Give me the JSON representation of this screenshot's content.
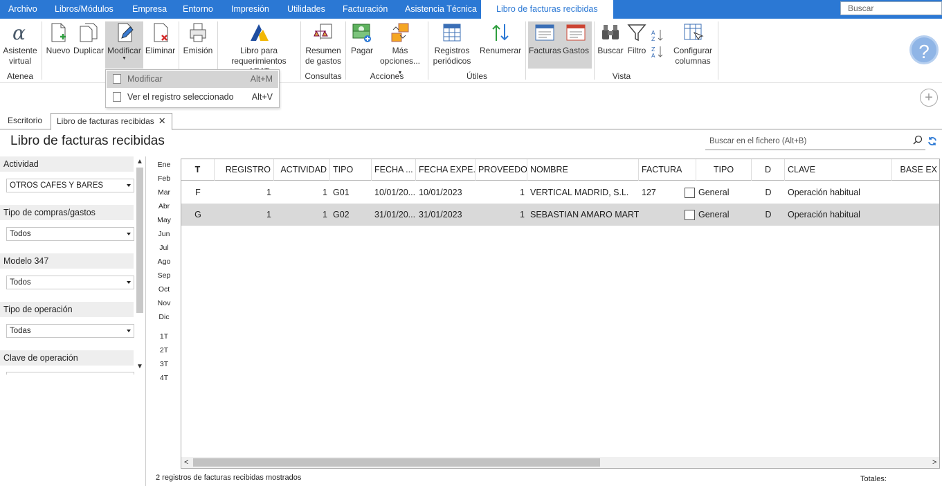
{
  "menubar": {
    "items": [
      "Archivo",
      "Libros/Módulos",
      "Empresa",
      "Entorno",
      "Impresión",
      "Utilidades",
      "Facturación",
      "Asistencia Técnica",
      "Libro de facturas recibidas"
    ],
    "search_placeholder": "Buscar"
  },
  "ribbon": {
    "asistente": [
      "Asistente",
      "virtual"
    ],
    "nuevo": "Nuevo",
    "duplicar": "Duplicar",
    "modificar": "Modificar",
    "eliminar": "Eliminar",
    "emision": "Emisión",
    "libro": [
      "Libro para",
      "requerimientos AEAT"
    ],
    "resumen": [
      "Resumen",
      "de gastos"
    ],
    "pagar": "Pagar",
    "mas": [
      "Más",
      "opciones..."
    ],
    "registros": [
      "Registros",
      "periódicos"
    ],
    "renumerar": "Renumerar",
    "facturas": "Facturas",
    "gastos": "Gastos",
    "buscar": "Buscar",
    "filtro": "Filtro",
    "configurar": [
      "Configurar",
      "columnas"
    ],
    "groups": {
      "atenea": "Atenea",
      "consultas": "Consultas",
      "acciones": "Acciones",
      "utiles": "Útiles",
      "vista": "Vista"
    }
  },
  "dropdown": {
    "items": [
      {
        "label": "Modificar",
        "shortcut": "Alt+M"
      },
      {
        "label": "Ver el registro seleccionado",
        "shortcut": "Alt+V"
      }
    ]
  },
  "tabs": [
    "Escritorio",
    "Libro de facturas recibidas"
  ],
  "page_title": "Libro de facturas recibidas",
  "file_search_placeholder": "Buscar en el fichero (Alt+B)",
  "filters": [
    {
      "label": "Actividad",
      "value": "OTROS CAFES Y BARES"
    },
    {
      "label": "Tipo de compras/gastos",
      "value": "Todos"
    },
    {
      "label": "Modelo 347",
      "value": "Todos"
    },
    {
      "label": "Tipo de operación",
      "value": "Todas"
    },
    {
      "label": "Clave de operación",
      "value": ""
    }
  ],
  "months": [
    "Ene",
    "Feb",
    "Mar",
    "Abr",
    "May",
    "Jun",
    "Jul",
    "Ago",
    "Sep",
    "Oct",
    "Nov",
    "Dic"
  ],
  "quarters": [
    "1T",
    "2T",
    "3T",
    "4T"
  ],
  "table": {
    "headers": [
      "T",
      "REGISTRO",
      "ACTIVIDAD",
      "TIPO",
      "FECHA ...",
      "FECHA EXPE...",
      "PROVEEDOR",
      "NOMBRE",
      "FACTURA",
      "TIPO",
      "D",
      "CLAVE",
      "BASE EX"
    ],
    "rows": [
      [
        "F",
        "1",
        "1",
        "G01",
        "10/01/20...",
        "10/01/2023",
        "1",
        "VERTICAL MADRID, S.L.",
        "127",
        "General",
        "D",
        "Operación habitual"
      ],
      [
        "G",
        "1",
        "1",
        "G02",
        "31/01/20...",
        "31/01/2023",
        "1",
        "SEBASTIAN AMARO MARTOS",
        "",
        "General",
        "D",
        "Operación habitual"
      ]
    ]
  },
  "status": "2 registros de facturas recibidas mostrados",
  "totales": "Totales:"
}
